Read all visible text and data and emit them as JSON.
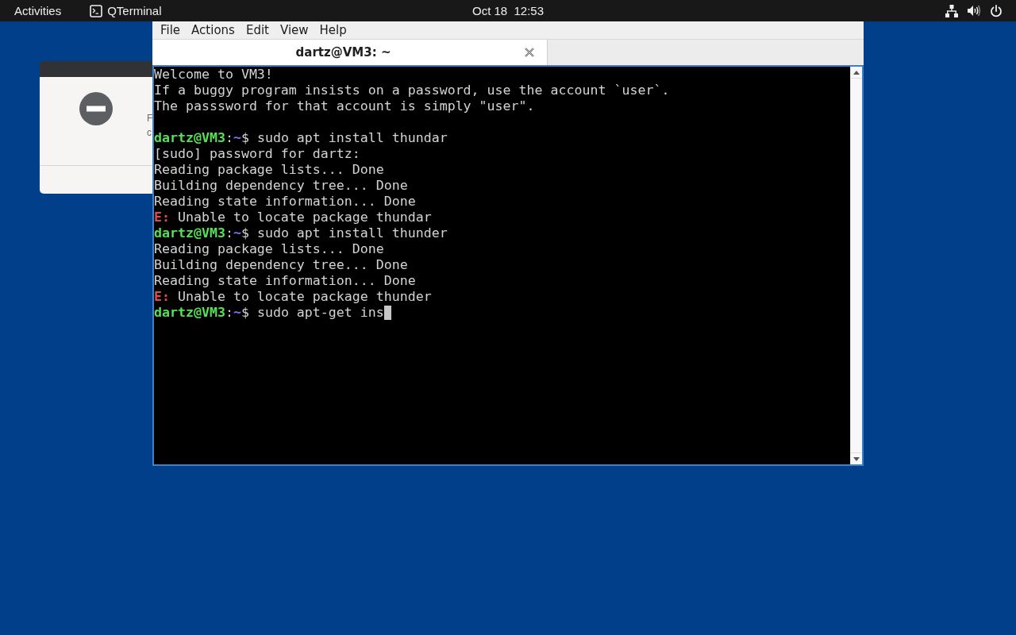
{
  "top_bar": {
    "activities": "Activities",
    "app_menu": "QTerminal",
    "clock": "Oct 18  12:53"
  },
  "background_dialog": {
    "text_lines": [
      "F",
      "c"
    ]
  },
  "terminal": {
    "menu": [
      "File",
      "Actions",
      "Edit",
      "View",
      "Help"
    ],
    "tabs": [
      {
        "title": "dartz@VM3: ~",
        "selected": true
      }
    ],
    "lines": [
      {
        "kind": "text",
        "text": "Welcome to VM3!"
      },
      {
        "kind": "text",
        "text": "If a buggy program insists on a password, use the account `user`."
      },
      {
        "kind": "text",
        "text": "The passsword for that account is simply \"user\"."
      },
      {
        "kind": "blank"
      },
      {
        "kind": "prompt",
        "user": "dartz@VM3",
        "separator": ":",
        "path": "~",
        "symbol": "$",
        "command": "sudo apt install thundar",
        "cursor": false
      },
      {
        "kind": "text",
        "text": "[sudo] password for dartz:"
      },
      {
        "kind": "text",
        "text": "Reading package lists... Done"
      },
      {
        "kind": "text",
        "text": "Building dependency tree... Done"
      },
      {
        "kind": "text",
        "text": "Reading state information... Done"
      },
      {
        "kind": "error",
        "tag": "E:",
        "message": "Unable to locate package thundar"
      },
      {
        "kind": "prompt",
        "user": "dartz@VM3",
        "separator": ":",
        "path": "~",
        "symbol": "$",
        "command": "sudo apt install thunder",
        "cursor": false
      },
      {
        "kind": "text",
        "text": "Reading package lists... Done"
      },
      {
        "kind": "text",
        "text": "Building dependency tree... Done"
      },
      {
        "kind": "text",
        "text": "Reading state information... Done"
      },
      {
        "kind": "error",
        "tag": "E:",
        "message": "Unable to locate package thunder"
      },
      {
        "kind": "prompt",
        "user": "dartz@VM3",
        "separator": ":",
        "path": "~",
        "symbol": "$",
        "command": "sudo apt-get ins",
        "cursor": true
      }
    ]
  }
}
